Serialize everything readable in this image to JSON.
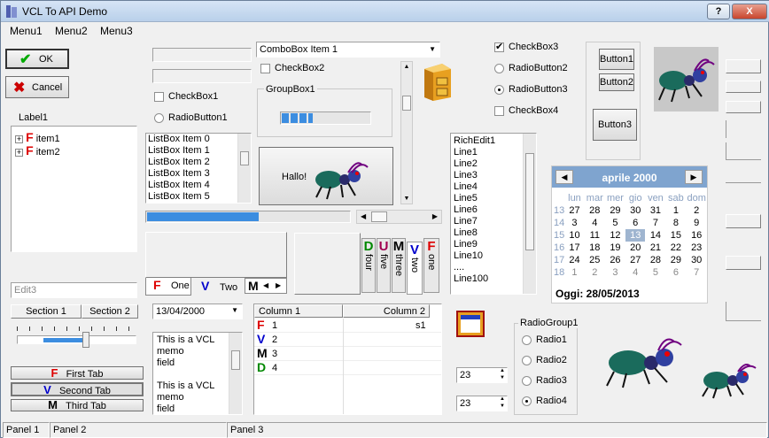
{
  "window": {
    "title": "VCL To API Demo",
    "help_label": "?",
    "close_label": "X"
  },
  "menu": [
    "Menu1",
    "Menu2",
    "Menu3"
  ],
  "ok_label": "OK",
  "cancel_label": "Cancel",
  "label1": "Label1",
  "tree": [
    {
      "label": "item1"
    },
    {
      "label": "item2"
    }
  ],
  "edit3_placeholder": "Edit3",
  "header_sections": [
    "Section 1",
    "Section 2"
  ],
  "tabs_vertical": [
    "First Tab",
    "Second Tab",
    "Third Tab"
  ],
  "checkbox1": "CheckBox1",
  "radiobutton1": "RadioButton1",
  "listbox": [
    "ListBox Item 0",
    "ListBox Item 1",
    "ListBox Item 2",
    "ListBox Item 3",
    "ListBox Item 4",
    "ListBox Item 5"
  ],
  "tabs_bottom": [
    "One",
    "Two",
    "M"
  ],
  "date_value": "13/04/2000",
  "memo_lines": [
    "This is a VCL",
    "memo",
    "field",
    "",
    "This is a VCL",
    "memo",
    "field"
  ],
  "combobox_value": "ComboBox Item 1",
  "checkbox2": "CheckBox2",
  "groupbox1": "GroupBox1",
  "progress": 0.35,
  "hallo_label": "Hallo!",
  "hscroll_progress": 0.55,
  "side_tabs": [
    {
      "letter": "D",
      "text": "four",
      "color": "grn"
    },
    {
      "letter": "U",
      "text": "five",
      "color": "mag"
    },
    {
      "letter": "M",
      "text": "three",
      "color": "blk"
    },
    {
      "letter": "V",
      "text": "two",
      "color": "blue"
    },
    {
      "letter": "F",
      "text": "one",
      "color": "red"
    }
  ],
  "grid": {
    "columns": [
      "Column 1",
      "Column 2"
    ],
    "rows": [
      {
        "icon": "F",
        "label": "1",
        "col2": "s1",
        "color": "red"
      },
      {
        "icon": "V",
        "label": "2",
        "col2": "",
        "color": "blue"
      },
      {
        "icon": "M",
        "label": "3",
        "col2": "",
        "color": "blk"
      },
      {
        "icon": "D",
        "label": "4",
        "col2": "",
        "color": "grn"
      }
    ]
  },
  "richedit": [
    "RichEdit1",
    "Line1",
    "Line2",
    "Line3",
    "Line4",
    "Line5",
    "Line6",
    "Line7",
    "Line8",
    "Line9",
    "Line10",
    "....",
    "Line100"
  ],
  "checkbox3": "CheckBox3",
  "radiobutton2": "RadioButton2",
  "radiobutton3": "RadioButton3",
  "checkbox4": "CheckBox4",
  "button1": "Button1",
  "button2": "Button2",
  "button3": "Button3",
  "calendar": {
    "month_title": "aprile 2000",
    "days": [
      "lun",
      "mar",
      "mer",
      "gio",
      "ven",
      "sab",
      "dom"
    ],
    "weeks": [
      {
        "wk": "13",
        "d": [
          "27",
          "28",
          "29",
          "30",
          "31",
          "1",
          "2"
        ]
      },
      {
        "wk": "14",
        "d": [
          "3",
          "4",
          "5",
          "6",
          "7",
          "8",
          "9"
        ]
      },
      {
        "wk": "15",
        "d": [
          "10",
          "11",
          "12",
          "13",
          "14",
          "15",
          "16"
        ]
      },
      {
        "wk": "16",
        "d": [
          "17",
          "18",
          "19",
          "20",
          "21",
          "22",
          "23"
        ]
      },
      {
        "wk": "17",
        "d": [
          "24",
          "25",
          "26",
          "27",
          "28",
          "29",
          "30"
        ]
      },
      {
        "wk": "18",
        "d": [
          "1",
          "2",
          "3",
          "4",
          "5",
          "6",
          "7"
        ]
      }
    ],
    "today": "Oggi: 28/05/2013"
  },
  "radiogroup": {
    "title": "RadioGroup1",
    "items": [
      "Radio1",
      "Radio2",
      "Radio3",
      "Radio4"
    ],
    "selected": 3
  },
  "spin1": "23",
  "spin2": "23",
  "status_panels": [
    "Panel 1",
    "Panel 2",
    "Panel 3"
  ]
}
